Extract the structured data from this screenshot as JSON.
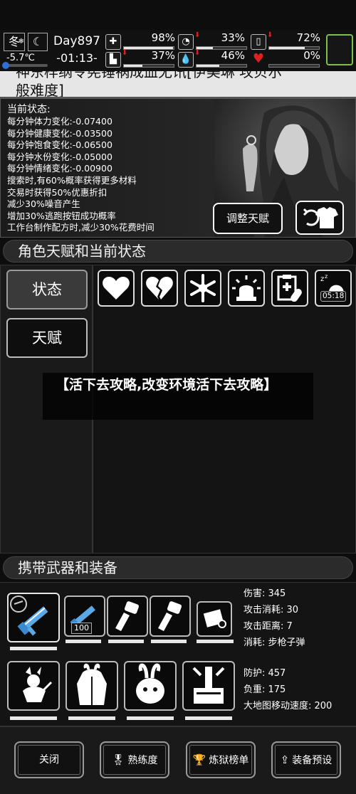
{
  "status_bar": {
    "season": "冬",
    "temperature": "-5.7℃",
    "day": "Day897",
    "time": "-01:13-",
    "stats": [
      {
        "name": "health",
        "value": "98%",
        "fill": 0.98,
        "decreasing": false
      },
      {
        "name": "hunger",
        "value": "33%",
        "fill": 0.33,
        "decreasing": true
      },
      {
        "name": "water",
        "value": "72%",
        "fill": 0.72,
        "decreasing": true
      },
      {
        "name": "stamina",
        "value": "37%",
        "fill": 0.37,
        "decreasing": true
      },
      {
        "name": "thirst",
        "value": "46%",
        "fill": 0.46,
        "decreasing": true
      },
      {
        "name": "mood",
        "value": "0%",
        "fill": 0.0,
        "decreasing": false
      }
    ]
  },
  "header": {
    "title_line1": "神东样纲令宪锤祸成血无讯[伊美琳 攻贝尔",
    "title_line2": "般难度]"
  },
  "status_panel": {
    "heading": "当前状态:",
    "lines": [
      "每分钟体力变化:-0.07400",
      "每分钟健康变化:-0.03500",
      "每分钟饱食变化:-0.06500",
      "每分钟水份变化:-0.05000",
      "每分钟情绪变化:-0.00900",
      "搜索时,有60%概率获得更多材料",
      "交易时获得50%优惠折扣",
      "减少30%噪音产生",
      "增加30%逃跑按钮成功概率",
      "工作台制作配方时,减少30%花费时间"
    ],
    "adjust_button": "调整天赋"
  },
  "talents_section": {
    "title": "角色天赋和当前状态",
    "tabs": [
      "状态",
      "天赋"
    ],
    "icons": [
      "heart-icon",
      "broken-heart-icon",
      "snowflake-icon",
      "alarm-icon",
      "medical-report-icon",
      "sleep-icon"
    ],
    "sleep_timer": "05:18"
  },
  "caption": {
    "text": "【活下去攻略,改变环境活下去攻略】"
  },
  "equipment_section": {
    "title": "携带武器和装备",
    "weapon_stats": [
      "伤害: 345",
      "攻击消耗: 30",
      "攻击距离: 7",
      "消耗: 步枪子弹"
    ],
    "ammo_count": "100",
    "armor_stats": [
      "防护: 457",
      "负重: 175",
      "大地图移动速度: 200"
    ]
  },
  "bottom_bar": {
    "close": "关闭",
    "proficiency": "熟练度",
    "ranking": "炼狱榜单",
    "preset": "装备预设"
  },
  "colors": {
    "accent_green": "#7ec04a",
    "decrease_red": "#e02020",
    "temp_blue": "#2f6fd8",
    "heart_red": "#e02020"
  }
}
